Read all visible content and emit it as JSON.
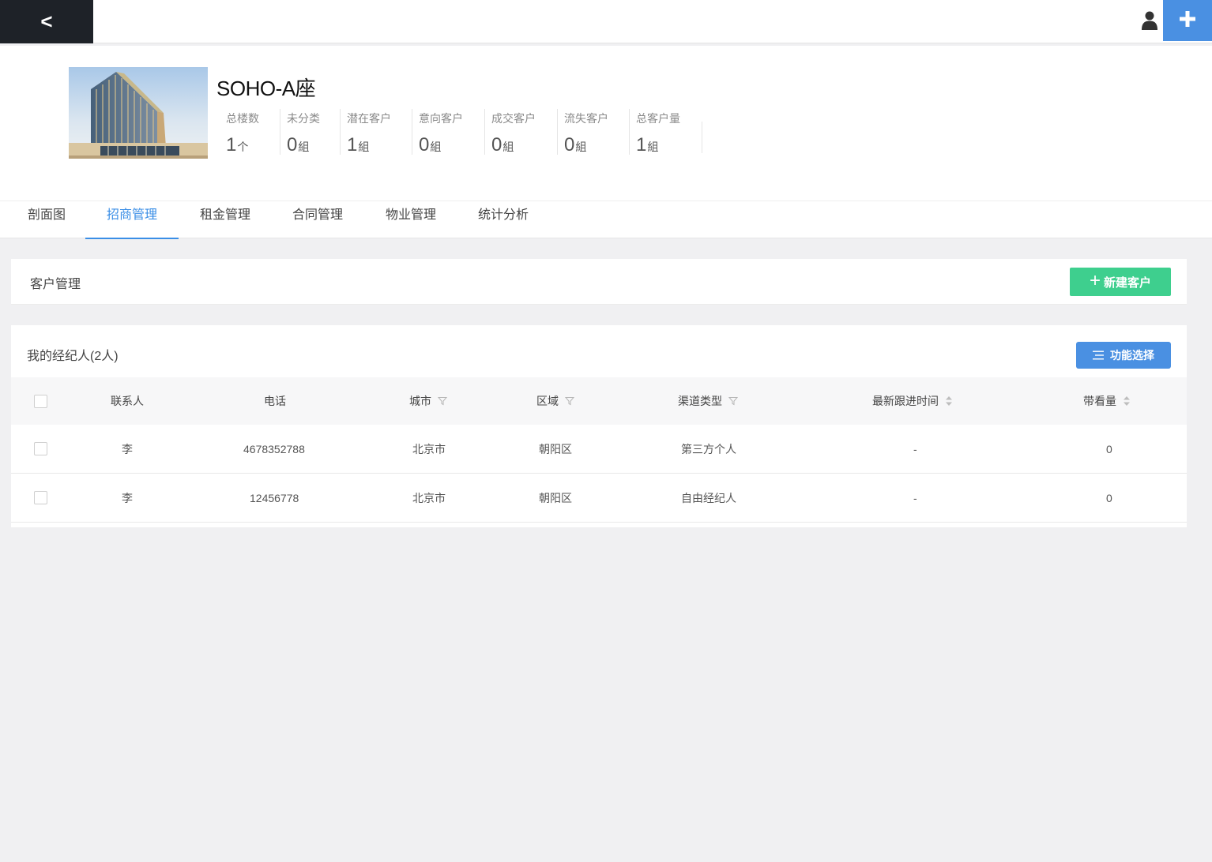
{
  "topbar": {
    "back_label": "<"
  },
  "building": {
    "title": "SOHO-A座"
  },
  "stats": [
    {
      "label": "总楼数",
      "value": "1",
      "unit": "个"
    },
    {
      "label": "未分类",
      "value": "0",
      "unit": "組"
    },
    {
      "label": "潜在客户",
      "value": "1",
      "unit": "組"
    },
    {
      "label": "意向客户",
      "value": "0",
      "unit": "組"
    },
    {
      "label": "成交客户",
      "value": "0",
      "unit": "組"
    },
    {
      "label": "流失客户",
      "value": "0",
      "unit": "組"
    },
    {
      "label": "总客户量",
      "value": "1",
      "unit": "組"
    }
  ],
  "tabs": [
    {
      "label": "剖面图"
    },
    {
      "label": "招商管理"
    },
    {
      "label": "租金管理"
    },
    {
      "label": "合同管理"
    },
    {
      "label": "物业管理"
    },
    {
      "label": "统计分析"
    }
  ],
  "active_tab": "招商管理",
  "customer_mgmt": {
    "title": "客户管理",
    "new_button": "新建客户"
  },
  "agents": {
    "title": "我的经纪人(2人)",
    "func_button": "功能选择",
    "columns": {
      "contact": "联系人",
      "phone": "电话",
      "city": "城市",
      "district": "区域",
      "channel": "渠道类型",
      "latest_followup": "最新跟进时间",
      "visits": "带看量"
    },
    "rows": [
      {
        "contact": "李",
        "phone": "4678352788",
        "city": "北京市",
        "district": "朝阳区",
        "channel": "第三方个人",
        "latest_followup": "-",
        "visits": "0"
      },
      {
        "contact": "李",
        "phone": "12456778",
        "city": "北京市",
        "district": "朝阳区",
        "channel": "自由经纪人",
        "latest_followup": "-",
        "visits": "0"
      }
    ]
  },
  "colors": {
    "accent_blue": "#4a90e2",
    "active_tab": "#3a8ee6",
    "new_button_green": "#3ecf8e",
    "topbar_dark": "#1e2228"
  },
  "icons": {
    "user": "user-icon",
    "plus": "plus-icon",
    "filter": "filter-icon",
    "sort": "sort-icon",
    "list": "list-icon"
  }
}
